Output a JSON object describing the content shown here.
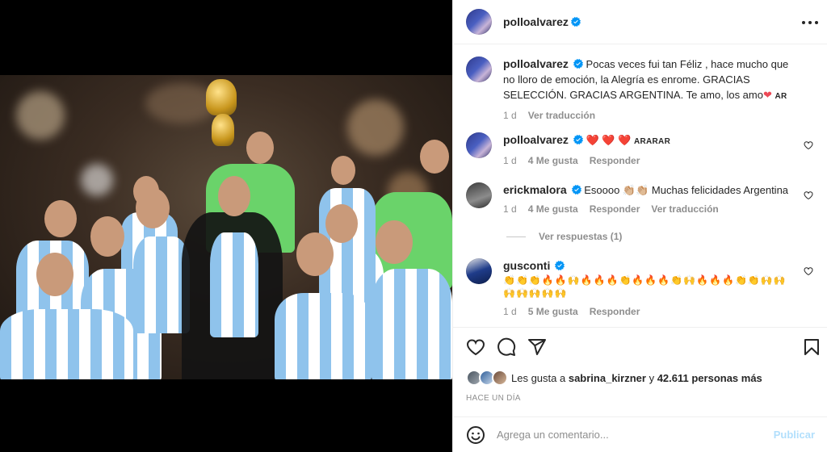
{
  "post": {
    "author": "polloalvarez",
    "verified_icon": "verified-badge-icon",
    "more_icon": "more-options-icon"
  },
  "caption": {
    "username": "polloalvarez",
    "text": "Pocas veces fui tan Féliz , hace mucho que no lloro de emoción, la Alegría es enrome. GRACIAS SELECCIÓN. GRACIAS ARGENTINA. Te amo, los amo",
    "emoji_heart": "❤",
    "flag": "AR",
    "age": "1 d",
    "translate": "Ver traducción"
  },
  "comments": [
    {
      "username": "polloalvarez",
      "text": "❤️ ❤️ ❤️",
      "flags": "ARARAR",
      "age": "1 d",
      "likes": "4 Me gusta",
      "reply": "Responder",
      "translate": ""
    },
    {
      "username": "erickmalora",
      "text": "Esoooo 👏🏼👏🏼 Muchas felicidades Argentina",
      "age": "1 d",
      "likes": "4 Me gusta",
      "reply": "Responder",
      "translate": "Ver traducción"
    },
    {
      "username": "gusconti",
      "text": "👏👏👏🔥🔥🙌🔥🔥🔥👏🔥🔥🔥👏🙌🔥🔥🔥👏👏🙌🙌🙌🙌🙌🙌🙌",
      "age": "1 d",
      "likes": "5 Me gusta",
      "reply": "Responder",
      "translate": ""
    }
  ],
  "replies_toggle": "Ver respuestas (1)",
  "actions": {
    "like_icon": "heart-icon",
    "comment_icon": "comment-icon",
    "share_icon": "share-icon",
    "save_icon": "bookmark-icon"
  },
  "likes": {
    "prefix": "Les gusta a",
    "user": "sabrina_kirzner",
    "middle": "y",
    "count": "42.611 personas más"
  },
  "timestamp": "HACE UN DÍA",
  "add_comment": {
    "placeholder": "Agrega un comentario...",
    "publish": "Publicar",
    "emoji_icon": "smiley-icon"
  },
  "colors": {
    "verified": "#0095f6",
    "heart": "#ed4956",
    "publish_disabled": "#b2dffc",
    "muted": "#8e8e8e"
  }
}
